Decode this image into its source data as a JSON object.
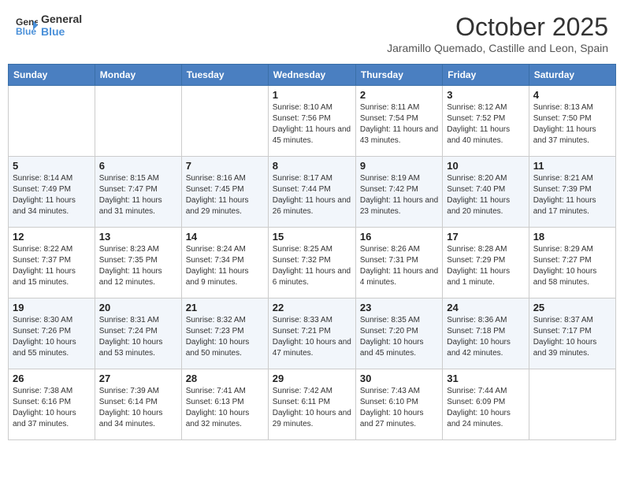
{
  "header": {
    "logo_line1": "General",
    "logo_line2": "Blue",
    "month": "October 2025",
    "location": "Jaramillo Quemado, Castille and Leon, Spain"
  },
  "weekdays": [
    "Sunday",
    "Monday",
    "Tuesday",
    "Wednesday",
    "Thursday",
    "Friday",
    "Saturday"
  ],
  "weeks": [
    [
      {
        "day": "",
        "info": ""
      },
      {
        "day": "",
        "info": ""
      },
      {
        "day": "",
        "info": ""
      },
      {
        "day": "1",
        "info": "Sunrise: 8:10 AM\nSunset: 7:56 PM\nDaylight: 11 hours and 45 minutes."
      },
      {
        "day": "2",
        "info": "Sunrise: 8:11 AM\nSunset: 7:54 PM\nDaylight: 11 hours and 43 minutes."
      },
      {
        "day": "3",
        "info": "Sunrise: 8:12 AM\nSunset: 7:52 PM\nDaylight: 11 hours and 40 minutes."
      },
      {
        "day": "4",
        "info": "Sunrise: 8:13 AM\nSunset: 7:50 PM\nDaylight: 11 hours and 37 minutes."
      }
    ],
    [
      {
        "day": "5",
        "info": "Sunrise: 8:14 AM\nSunset: 7:49 PM\nDaylight: 11 hours and 34 minutes."
      },
      {
        "day": "6",
        "info": "Sunrise: 8:15 AM\nSunset: 7:47 PM\nDaylight: 11 hours and 31 minutes."
      },
      {
        "day": "7",
        "info": "Sunrise: 8:16 AM\nSunset: 7:45 PM\nDaylight: 11 hours and 29 minutes."
      },
      {
        "day": "8",
        "info": "Sunrise: 8:17 AM\nSunset: 7:44 PM\nDaylight: 11 hours and 26 minutes."
      },
      {
        "day": "9",
        "info": "Sunrise: 8:19 AM\nSunset: 7:42 PM\nDaylight: 11 hours and 23 minutes."
      },
      {
        "day": "10",
        "info": "Sunrise: 8:20 AM\nSunset: 7:40 PM\nDaylight: 11 hours and 20 minutes."
      },
      {
        "day": "11",
        "info": "Sunrise: 8:21 AM\nSunset: 7:39 PM\nDaylight: 11 hours and 17 minutes."
      }
    ],
    [
      {
        "day": "12",
        "info": "Sunrise: 8:22 AM\nSunset: 7:37 PM\nDaylight: 11 hours and 15 minutes."
      },
      {
        "day": "13",
        "info": "Sunrise: 8:23 AM\nSunset: 7:35 PM\nDaylight: 11 hours and 12 minutes."
      },
      {
        "day": "14",
        "info": "Sunrise: 8:24 AM\nSunset: 7:34 PM\nDaylight: 11 hours and 9 minutes."
      },
      {
        "day": "15",
        "info": "Sunrise: 8:25 AM\nSunset: 7:32 PM\nDaylight: 11 hours and 6 minutes."
      },
      {
        "day": "16",
        "info": "Sunrise: 8:26 AM\nSunset: 7:31 PM\nDaylight: 11 hours and 4 minutes."
      },
      {
        "day": "17",
        "info": "Sunrise: 8:28 AM\nSunset: 7:29 PM\nDaylight: 11 hours and 1 minute."
      },
      {
        "day": "18",
        "info": "Sunrise: 8:29 AM\nSunset: 7:27 PM\nDaylight: 10 hours and 58 minutes."
      }
    ],
    [
      {
        "day": "19",
        "info": "Sunrise: 8:30 AM\nSunset: 7:26 PM\nDaylight: 10 hours and 55 minutes."
      },
      {
        "day": "20",
        "info": "Sunrise: 8:31 AM\nSunset: 7:24 PM\nDaylight: 10 hours and 53 minutes."
      },
      {
        "day": "21",
        "info": "Sunrise: 8:32 AM\nSunset: 7:23 PM\nDaylight: 10 hours and 50 minutes."
      },
      {
        "day": "22",
        "info": "Sunrise: 8:33 AM\nSunset: 7:21 PM\nDaylight: 10 hours and 47 minutes."
      },
      {
        "day": "23",
        "info": "Sunrise: 8:35 AM\nSunset: 7:20 PM\nDaylight: 10 hours and 45 minutes."
      },
      {
        "day": "24",
        "info": "Sunrise: 8:36 AM\nSunset: 7:18 PM\nDaylight: 10 hours and 42 minutes."
      },
      {
        "day": "25",
        "info": "Sunrise: 8:37 AM\nSunset: 7:17 PM\nDaylight: 10 hours and 39 minutes."
      }
    ],
    [
      {
        "day": "26",
        "info": "Sunrise: 7:38 AM\nSunset: 6:16 PM\nDaylight: 10 hours and 37 minutes."
      },
      {
        "day": "27",
        "info": "Sunrise: 7:39 AM\nSunset: 6:14 PM\nDaylight: 10 hours and 34 minutes."
      },
      {
        "day": "28",
        "info": "Sunrise: 7:41 AM\nSunset: 6:13 PM\nDaylight: 10 hours and 32 minutes."
      },
      {
        "day": "29",
        "info": "Sunrise: 7:42 AM\nSunset: 6:11 PM\nDaylight: 10 hours and 29 minutes."
      },
      {
        "day": "30",
        "info": "Sunrise: 7:43 AM\nSunset: 6:10 PM\nDaylight: 10 hours and 27 minutes."
      },
      {
        "day": "31",
        "info": "Sunrise: 7:44 AM\nSunset: 6:09 PM\nDaylight: 10 hours and 24 minutes."
      },
      {
        "day": "",
        "info": ""
      }
    ]
  ]
}
